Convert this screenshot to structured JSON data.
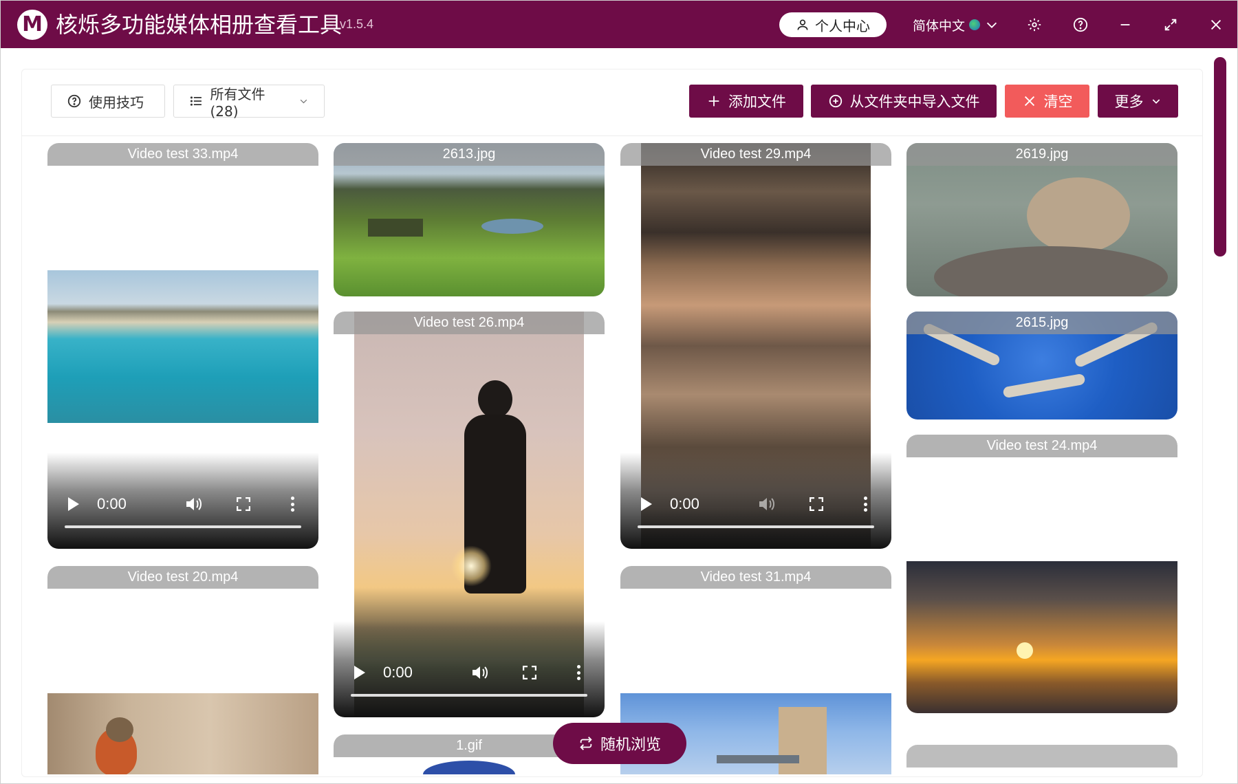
{
  "app": {
    "logo_letter": "M",
    "title": "核烁多功能媒体相册查看工具",
    "version": "- v1.5.4"
  },
  "titlebar": {
    "user_center": "个人中心",
    "language": "简体中文"
  },
  "toolbar": {
    "tips": "使用技巧",
    "filter": "所有文件 (28)",
    "add_files": "添加文件",
    "import_folder": "从文件夹中导入文件",
    "clear": "清空",
    "more": "更多"
  },
  "media": [
    {
      "name": "Video test 33.mp4",
      "type": "video",
      "time": "0:00"
    },
    {
      "name": "2613.jpg",
      "type": "image"
    },
    {
      "name": "Video test 29.mp4",
      "type": "video",
      "time": "0:00"
    },
    {
      "name": "2619.jpg",
      "type": "image"
    },
    {
      "name": "Video test 26.mp4",
      "type": "video",
      "time": "0:00"
    },
    {
      "name": "2615.jpg",
      "type": "image"
    },
    {
      "name": "Video test 24.mp4",
      "type": "video"
    },
    {
      "name": "Video test 20.mp4",
      "type": "video"
    },
    {
      "name": "Video test 31.mp4",
      "type": "video"
    },
    {
      "name": "1.gif",
      "type": "image"
    }
  ],
  "random_browse": "随机浏览",
  "colors": {
    "brand": "#6e0c47",
    "danger": "#f25b5b"
  }
}
